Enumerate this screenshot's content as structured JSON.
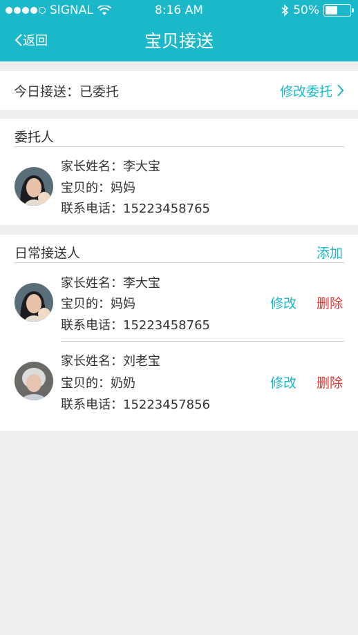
{
  "status": {
    "carrier": "SIGNAL",
    "time": "8:16 AM",
    "battery": "50%",
    "battery_level": 0.5
  },
  "nav": {
    "back_label": "返回",
    "title": "宝贝接送"
  },
  "today": {
    "text": "今日接送：已委托",
    "modify_label": "修改委托"
  },
  "delegate": {
    "title": "委托人",
    "person": {
      "name": "家长姓名：李大宝",
      "relation": "宝贝的：妈妈",
      "phone": "联系电话：15223458765"
    }
  },
  "regular": {
    "title": "日常接送人",
    "add_label": "添加",
    "edit_label": "修改",
    "delete_label": "删除",
    "people": [
      {
        "name": "家长姓名：李大宝",
        "relation": "宝贝的：妈妈",
        "phone": "联系电话：15223458765"
      },
      {
        "name": "家长姓名：刘老宝",
        "relation": "宝贝的：奶奶",
        "phone": "联系电话：15223457856"
      }
    ]
  },
  "colors": {
    "accent": "#1ab8c9",
    "danger": "#e53935",
    "background": "#eeeeee"
  }
}
